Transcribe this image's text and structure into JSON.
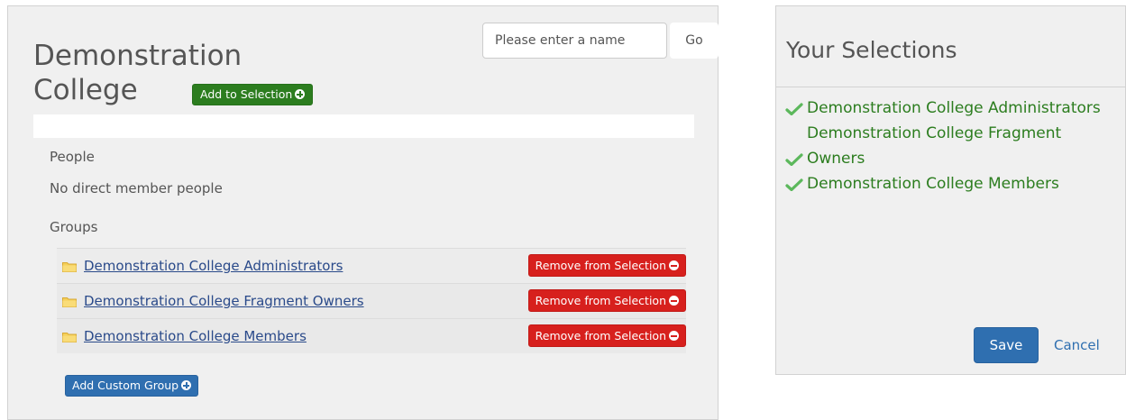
{
  "entity": {
    "title_line1": "Demonstration",
    "title_line2": "College",
    "add_to_selection_label": "Add to Selection"
  },
  "search": {
    "placeholder": "Please enter a name",
    "go_label": "Go"
  },
  "people": {
    "heading": "People",
    "empty_text": "No direct member people"
  },
  "groups": {
    "heading": "Groups",
    "items": [
      {
        "name": "Demonstration College Administrators",
        "remove_label": "Remove from Selection"
      },
      {
        "name": "Demonstration College Fragment Owners",
        "remove_label": "Remove from Selection"
      },
      {
        "name": "Demonstration College Members",
        "remove_label": "Remove from Selection"
      }
    ],
    "add_custom_label": "Add Custom Group"
  },
  "selections": {
    "title": "Your Selections",
    "items": [
      {
        "label": "Demonstration College Administrators"
      },
      {
        "label": "Demonstration College Fragment Owners"
      },
      {
        "label": "Demonstration College Members"
      }
    ],
    "save_label": "Save",
    "cancel_label": "Cancel"
  },
  "colors": {
    "green": "#2c7d1f",
    "red": "#d7201d",
    "blue": "#2f6fb0",
    "panel_bg": "#f0f0f0",
    "link": "#2a4a8a"
  },
  "icons": {
    "add": "plus-circle-icon",
    "remove": "minus-circle-icon",
    "folder": "folder-icon",
    "selected": "check-icon"
  }
}
